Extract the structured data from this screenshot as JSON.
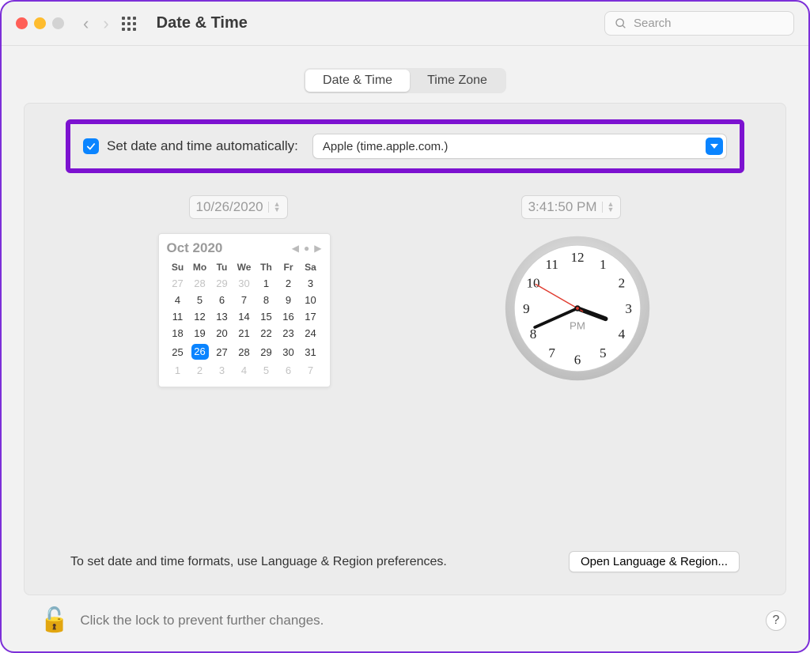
{
  "window": {
    "title": "Date & Time"
  },
  "search": {
    "placeholder": "Search"
  },
  "tabs": {
    "date_time": "Date & Time",
    "time_zone": "Time Zone",
    "active": "date_time"
  },
  "auto": {
    "checkbox_label": "Set date and time automatically:",
    "server": "Apple (time.apple.com.)"
  },
  "date_field": "10/26/2020",
  "time_field": "3:41:50 PM",
  "calendar": {
    "title": "Oct 2020",
    "weekdays": [
      "Su",
      "Mo",
      "Tu",
      "We",
      "Th",
      "Fr",
      "Sa"
    ],
    "selected_day": 26,
    "leading_dim": [
      27,
      28,
      29,
      30
    ],
    "days": [
      1,
      2,
      3,
      4,
      5,
      6,
      7,
      8,
      9,
      10,
      11,
      12,
      13,
      14,
      15,
      16,
      17,
      18,
      19,
      20,
      21,
      22,
      23,
      24,
      25,
      26,
      27,
      28,
      29,
      30,
      31
    ],
    "trailing_dim": [
      1,
      2,
      3,
      4,
      5,
      6,
      7
    ]
  },
  "clock": {
    "ampm": "PM",
    "hour": 3,
    "minute": 41,
    "second": 50,
    "numerals": [
      "12",
      "1",
      "2",
      "3",
      "4",
      "5",
      "6",
      "7",
      "8",
      "9",
      "10",
      "11"
    ]
  },
  "hint": "To set date and time formats, use Language & Region preferences.",
  "open_lang_region": "Open Language & Region...",
  "lock_hint": "Click the lock to prevent further changes.",
  "help": "?"
}
